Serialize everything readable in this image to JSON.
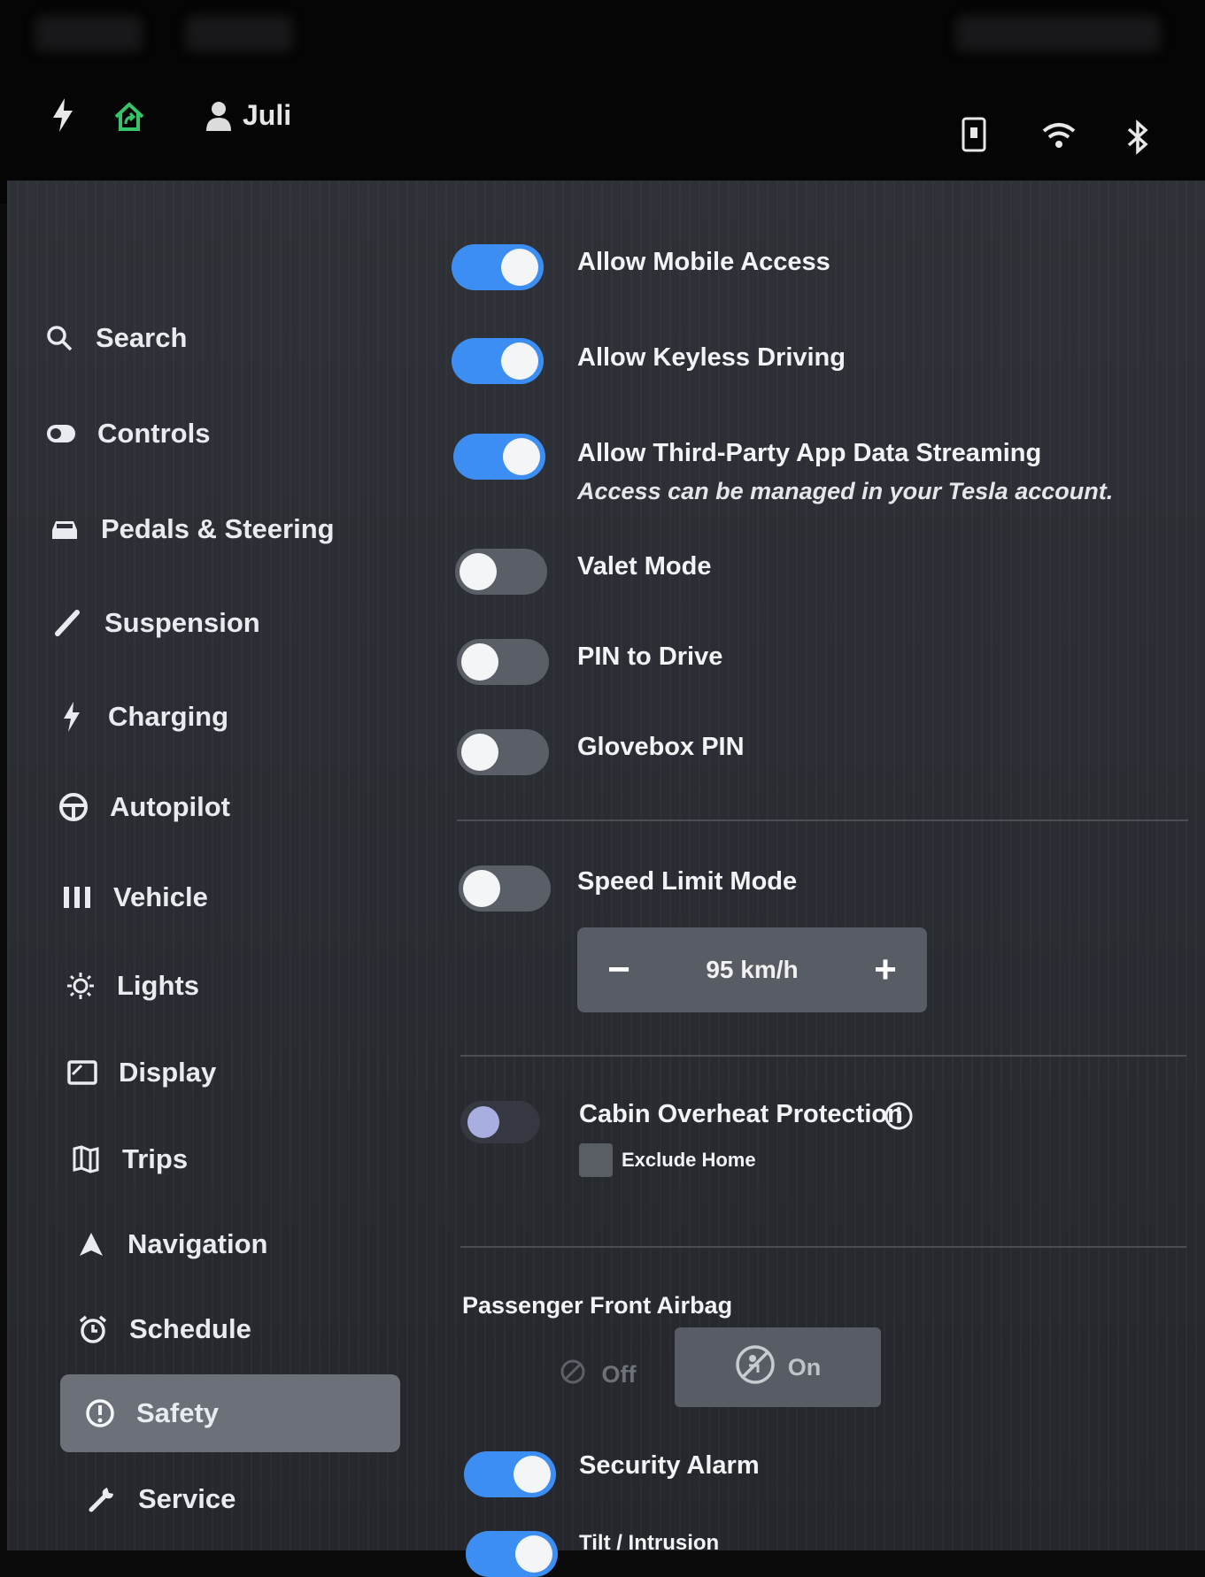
{
  "topbar": {
    "user_name": "Juli"
  },
  "sidebar": {
    "items": [
      {
        "label": "Search",
        "icon": "search-icon"
      },
      {
        "label": "Controls",
        "icon": "toggle-icon"
      },
      {
        "label": "Pedals & Steering",
        "icon": "car-icon"
      },
      {
        "label": "Suspension",
        "icon": "suspension-icon"
      },
      {
        "label": "Charging",
        "icon": "lightning-icon"
      },
      {
        "label": "Autopilot",
        "icon": "steering-wheel-icon"
      },
      {
        "label": "Vehicle",
        "icon": "vehicle-bars-icon"
      },
      {
        "label": "Lights",
        "icon": "sun-icon"
      },
      {
        "label": "Display",
        "icon": "display-icon"
      },
      {
        "label": "Trips",
        "icon": "trips-icon"
      },
      {
        "label": "Navigation",
        "icon": "navigation-arrow-icon"
      },
      {
        "label": "Schedule",
        "icon": "alarm-clock-icon"
      },
      {
        "label": "Safety",
        "icon": "safety-icon",
        "active": true
      },
      {
        "label": "Service",
        "icon": "wrench-icon"
      }
    ]
  },
  "settings": {
    "mobile_access": {
      "label": "Allow Mobile Access",
      "on": true
    },
    "keyless_driving": {
      "label": "Allow Keyless Driving",
      "on": true
    },
    "third_party_streaming": {
      "label": "Allow Third-Party App Data Streaming",
      "sublabel": "Access can be managed in your Tesla account.",
      "on": true
    },
    "valet_mode": {
      "label": "Valet Mode",
      "on": false
    },
    "pin_to_drive": {
      "label": "PIN to Drive",
      "on": false
    },
    "glovebox_pin": {
      "label": "Glovebox PIN",
      "on": false
    },
    "speed_limit_mode": {
      "label": "Speed Limit Mode",
      "on": false,
      "value": "95 km/h",
      "minus": "−",
      "plus": "+"
    },
    "cabin_overheat": {
      "label": "Cabin Overheat Protection",
      "on": false,
      "exclude_home_label": "Exclude Home",
      "exclude_home_checked": false
    },
    "passenger_airbag": {
      "label": "Passenger Front Airbag",
      "off_label": "Off",
      "on_label": "On",
      "selected": "On"
    },
    "security_alarm": {
      "label": "Security Alarm",
      "on": true
    },
    "tilt_intrusion": {
      "label": "Tilt / Intrusion",
      "on": true
    }
  },
  "colors": {
    "accent": "#3d8ef2",
    "home_icon": "#35c46a"
  }
}
